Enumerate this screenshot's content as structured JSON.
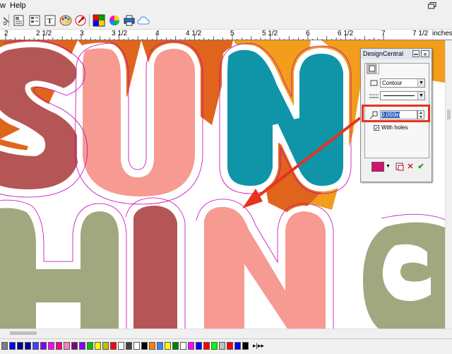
{
  "menubar": {
    "items": [
      "w",
      "Help"
    ]
  },
  "ruler": {
    "unit_label": "inches",
    "labels": [
      "2",
      "2 1/2",
      "3",
      "3 1/2",
      "4",
      "4 1/2",
      "5",
      "5 1/2",
      "6",
      "6 1/2",
      "7",
      "7 1/2"
    ]
  },
  "canvas": {
    "design_words": [
      "SUN",
      "HINE"
    ]
  },
  "design_central": {
    "title": "DesignCentral",
    "mode_value": "Contour",
    "offset_value": "0.050in",
    "with_holes_label": "With holes",
    "with_holes_checked": true,
    "fill_color": "#d4106e"
  },
  "colors": {
    "highlight": "#e8321e",
    "arrow": "#e8321e",
    "sun_s": "#b55656",
    "sun_u": "#f69a92",
    "sun_n": "#1094a8",
    "hine_h": "#a1a77f",
    "hine_i": "#b55656",
    "hine_n": "#f69a92",
    "orange": "#e1641d",
    "amber": "#f29d1b"
  },
  "palette": {
    "swatches": [
      "#808080",
      "#0000ff",
      "#000080",
      "#0000a0",
      "#4040ff",
      "#8000ff",
      "#ff00ff",
      "#ff0080",
      "#ff80c0",
      "#800080",
      "#8000ff",
      "#00c000",
      "#ffff00",
      "#c0c000",
      "#ff0000",
      "#ffffff",
      "#404040",
      "#ffffff",
      "#000000",
      "#ff8000",
      "#4080ff",
      "#ffff00",
      "#008000",
      "#ffffff",
      "#ff00ff",
      "#0000ff",
      "#ff0000",
      "#00ff00",
      "#c0c0c0",
      "#ff0000",
      "#0000ff",
      "#000000"
    ]
  }
}
